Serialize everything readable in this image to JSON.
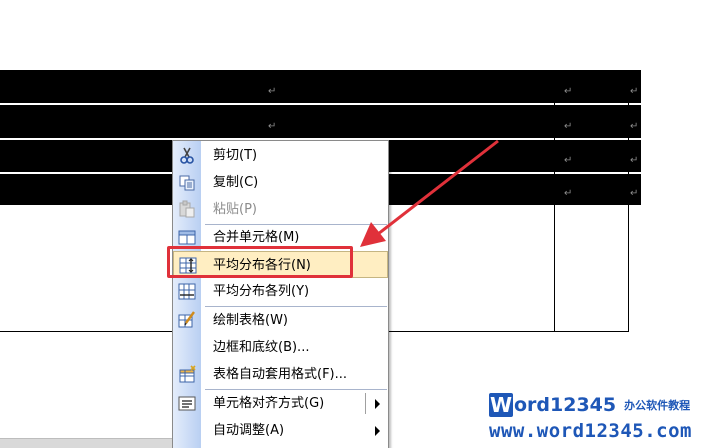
{
  "table": {
    "return_mark": "↵"
  },
  "context_menu": {
    "items": [
      {
        "label": "剪切(T)",
        "icon": "scissors-icon",
        "enabled": true
      },
      {
        "label": "复制(C)",
        "icon": "copy-icon",
        "enabled": true
      },
      {
        "label": "粘贴(P)",
        "icon": "paste-icon",
        "enabled": false
      },
      {
        "label": "合并单元格(M)",
        "icon": "merge-cells-icon",
        "enabled": true
      },
      {
        "label": "平均分布各行(N)",
        "icon": "distribute-rows-icon",
        "enabled": true,
        "highlighted": true
      },
      {
        "label": "平均分布各列(Y)",
        "icon": "distribute-columns-icon",
        "enabled": true
      },
      {
        "label": "绘制表格(W)",
        "icon": "draw-table-icon",
        "enabled": true
      },
      {
        "label": "边框和底纹(B)...",
        "icon": "",
        "enabled": true
      },
      {
        "label": "表格自动套用格式(F)...",
        "icon": "autoformat-icon",
        "enabled": true
      },
      {
        "label": "单元格对齐方式(G)",
        "icon": "align-icon",
        "enabled": true,
        "submenu": true
      },
      {
        "label": "自动调整(A)",
        "icon": "",
        "enabled": true,
        "submenu": true
      }
    ]
  },
  "watermark": {
    "brand_w": "W",
    "brand_rest": "ord12345",
    "tagline": "办公软件教程",
    "url": "www.word12345.com"
  },
  "colors": {
    "highlight_box": "#e0313a",
    "brand": "#1e57b7",
    "menu_highlight": "#ffeec2"
  }
}
